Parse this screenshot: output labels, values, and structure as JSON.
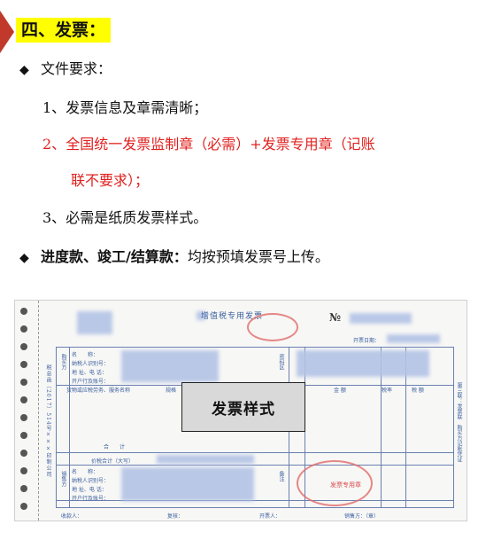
{
  "section": {
    "heading": "四、发票："
  },
  "doc_requirements": {
    "title": "文件要求：",
    "items": [
      {
        "number": "1、",
        "text": "发票信息及章需清晰；"
      },
      {
        "number": "2、",
        "text_line1": "全国统一发票监制章（必需）+发票专用章（记账",
        "text_line2": "联不要求）；"
      },
      {
        "number": "3、",
        "text": "必需是纸质发票样式。"
      }
    ]
  },
  "progress_payment": {
    "bold": "进度款、竣工/结算款：",
    "text": "均按预填发票号上传。"
  },
  "invoice_sample": {
    "label": "发票样式",
    "title": "增值税专用发票",
    "number_mark": "№",
    "date_label": "开票日期：",
    "fields": {
      "buyer": "购买方",
      "name": "名　　称：",
      "tax_id": "纳税人识别号：",
      "address": "地 址、电 话：",
      "bank": "开户行及账号：",
      "goods": "货物或应税劳务、服务名称",
      "spec": "规格",
      "amount": "金 额",
      "tax_rate": "税率",
      "tax": "税 额",
      "total": "合　　计",
      "total_words": "价税合计（大写）",
      "seller": "销售方",
      "cipher": "密码区",
      "remark": "备注",
      "payee": "收款人：",
      "reviewer": "复核：",
      "drawer": "开票人：",
      "seller_seal": "销售方：（章）"
    },
    "right_label": "第三联：发票联　购买方记账凭证",
    "left_label": "税总函〔2017〕514号×××印制公司",
    "stamp_text": "发票专用章",
    "colors": {
      "ink": "#3b5fa0",
      "seal": "#e06a6a"
    }
  }
}
